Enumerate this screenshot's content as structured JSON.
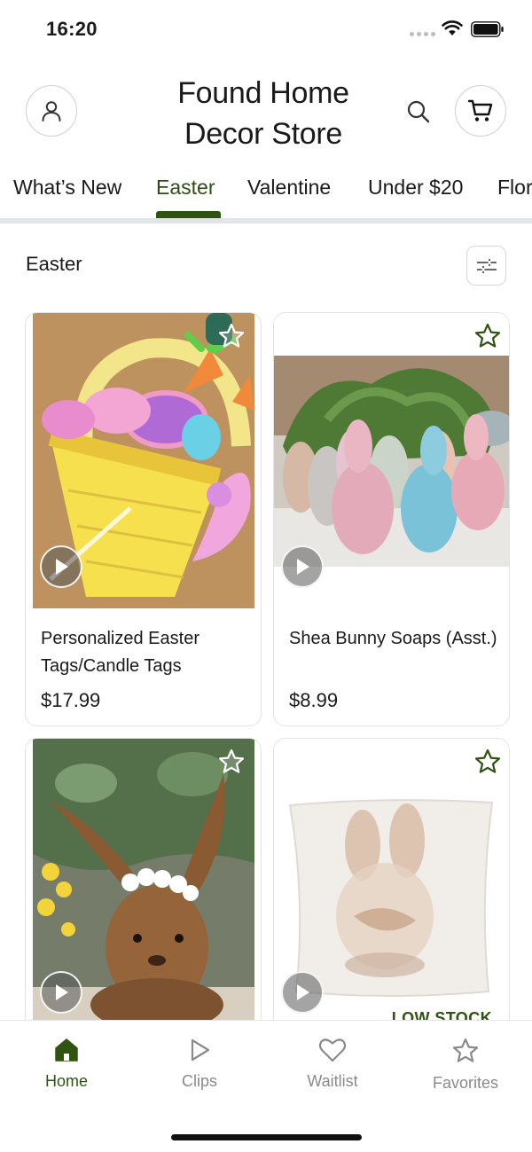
{
  "status_bar": {
    "time": "16:20"
  },
  "header": {
    "store_title": "Found Home Decor Store",
    "account_icon": "user-icon",
    "search_icon": "search-icon",
    "cart_icon": "cart-icon"
  },
  "tabs": [
    {
      "label": "What’s New",
      "active": false
    },
    {
      "label": "Easter",
      "active": true
    },
    {
      "label": "Valentine",
      "active": false
    },
    {
      "label": "Under $20",
      "active": false
    },
    {
      "label": "Flor",
      "active": false
    }
  ],
  "section": {
    "title": "Easter",
    "filter_icon": "sliders-icon"
  },
  "products": [
    {
      "name": "Personalized Easter Tags/Candle Tags",
      "price": "$17.99",
      "has_video": true,
      "favorite": false
    },
    {
      "name": "Shea Bunny Soaps (Asst.)",
      "price": "$8.99",
      "has_video": true,
      "favorite": false
    },
    {
      "name": "",
      "price": "",
      "has_video": true,
      "favorite": false
    },
    {
      "name": "",
      "price": "",
      "has_video": true,
      "favorite": false,
      "badge": "LOW STOCK"
    }
  ],
  "bottom_nav": [
    {
      "label": "Home",
      "icon": "home-icon",
      "active": true
    },
    {
      "label": "Clips",
      "icon": "play-icon",
      "active": false
    },
    {
      "label": "Waitlist",
      "icon": "heart-icon",
      "active": false
    },
    {
      "label": "Favorites",
      "icon": "star-icon",
      "active": false
    }
  ],
  "colors": {
    "accent": "#2e5410",
    "tab_divider": "#e2e5e8",
    "inactive_nav": "#8a8a8a"
  }
}
